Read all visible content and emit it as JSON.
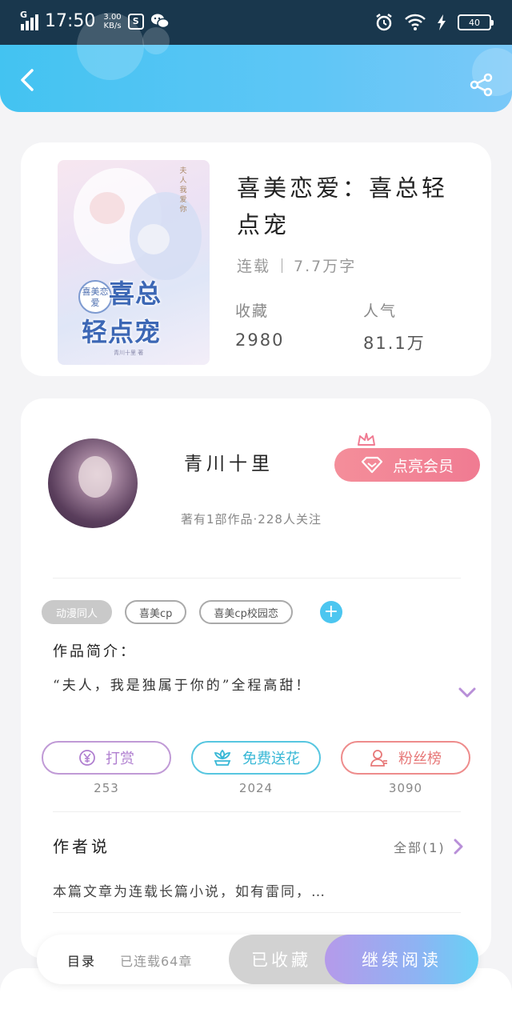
{
  "status_bar": {
    "network": "G",
    "time": "17:50",
    "speed_value": "3.00",
    "speed_unit": "KB/s",
    "battery": "40"
  },
  "book": {
    "title": "喜美恋爱：喜总轻点宠",
    "serial_status": "连载",
    "word_count": "7.7万字",
    "favorites_label": "收藏",
    "favorites_value": "2980",
    "popularity_label": "人气",
    "popularity_value": "81.1万",
    "cover": {
      "tag": "喜美恋爱",
      "big_line1": "喜总",
      "big_line2": "轻点宠",
      "side_text": "夫人我爱你",
      "footer": "青川十里 著"
    }
  },
  "author": {
    "name": "青川十里",
    "meta": "著有1部作品·228人关注",
    "vip_button": "点亮会员"
  },
  "tags": [
    "动漫同人",
    "喜美cp",
    "喜美cp校园恋"
  ],
  "tag_add": "+",
  "intro": {
    "title": "作品简介：",
    "text": "“夫人，我是独属于你的”全程高甜！"
  },
  "actions": [
    {
      "label": "打赏",
      "count": "253"
    },
    {
      "label": "免费送花",
      "count": "2024"
    },
    {
      "label": "粉丝榜",
      "count": "3090"
    }
  ],
  "author_says": {
    "title": "作者说",
    "all": "全部(1)",
    "text": "本篇文章为连载长篇小说，如有雷同，…"
  },
  "bottom_bar": {
    "toc": "目录",
    "toc_meta": "已连载64章",
    "collected": "已收藏",
    "continue": "继续阅读"
  },
  "colors": {
    "header": "#4fc4f3",
    "vip": "#f07b92",
    "reward": "#b07fd0",
    "flower": "#38b8d6",
    "fans": "#e77878"
  }
}
